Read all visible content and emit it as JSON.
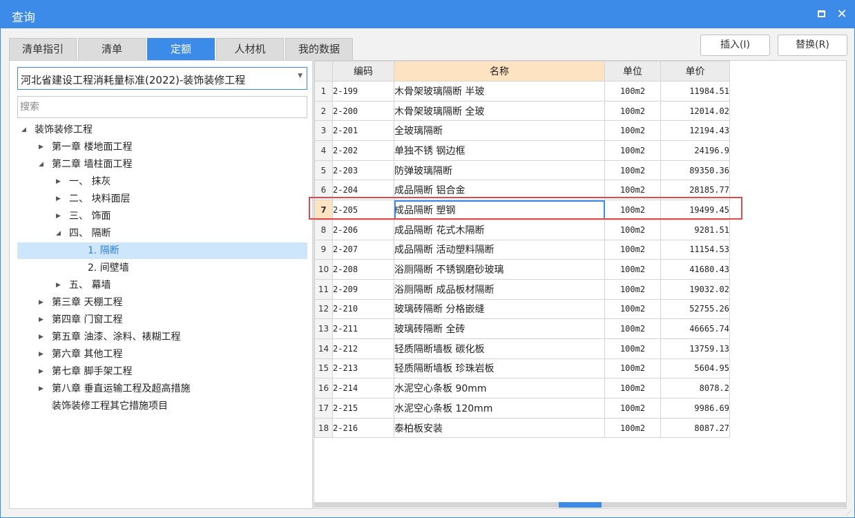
{
  "window": {
    "title": "查询"
  },
  "tabs": [
    "清单指引",
    "清单",
    "定额",
    "人材机",
    "我的数据"
  ],
  "active_tab": "定额",
  "buttons": {
    "insert": "插入(I)",
    "replace": "替换(R)"
  },
  "left": {
    "select_value": "河北省建设工程消耗量标准(2022)-装饰装修工程",
    "search_placeholder": "搜索",
    "tree": [
      {
        "label": "装饰装修工程",
        "level": 0,
        "caret": "expanded"
      },
      {
        "label": "第一章 楼地面工程",
        "level": 1,
        "caret": "collapsed"
      },
      {
        "label": "第二章 墙柱面工程",
        "level": 1,
        "caret": "expanded"
      },
      {
        "label": "一、 抹灰",
        "level": 2,
        "caret": "collapsed"
      },
      {
        "label": "二、 块料面层",
        "level": 2,
        "caret": "collapsed"
      },
      {
        "label": "三、 饰面",
        "level": 2,
        "caret": "collapsed"
      },
      {
        "label": "四、 隔断",
        "level": 2,
        "caret": "expanded"
      },
      {
        "label": "1. 隔断",
        "level": 3,
        "caret": "none",
        "selected": true
      },
      {
        "label": "2. 间壁墙",
        "level": 3,
        "caret": "none"
      },
      {
        "label": "五、 幕墙",
        "level": 2,
        "caret": "collapsed"
      },
      {
        "label": "第三章 天棚工程",
        "level": 1,
        "caret": "collapsed"
      },
      {
        "label": "第四章 门窗工程",
        "level": 1,
        "caret": "collapsed"
      },
      {
        "label": "第五章 油漆、涂料、裱糊工程",
        "level": 1,
        "caret": "collapsed"
      },
      {
        "label": "第六章 其他工程",
        "level": 1,
        "caret": "collapsed"
      },
      {
        "label": "第七章 脚手架工程",
        "level": 1,
        "caret": "collapsed"
      },
      {
        "label": "第八章 垂直运输工程及超高措施",
        "level": 1,
        "caret": "collapsed"
      },
      {
        "label": "装饰装修工程其它措施项目",
        "level": 1,
        "caret": "none"
      }
    ]
  },
  "table": {
    "headers": {
      "code": "编码",
      "name": "名称",
      "unit": "单位",
      "price": "单价"
    },
    "selected_row": 7,
    "rows": [
      {
        "no": "1",
        "code": "2-199",
        "name": "木骨架玻璃隔断 半玻",
        "unit": "100m2",
        "price": "11984.51"
      },
      {
        "no": "2",
        "code": "2-200",
        "name": "木骨架玻璃隔断 全玻",
        "unit": "100m2",
        "price": "12014.02"
      },
      {
        "no": "3",
        "code": "2-201",
        "name": "全玻璃隔断",
        "unit": "100m2",
        "price": "12194.43"
      },
      {
        "no": "4",
        "code": "2-202",
        "name": "单独不锈 钢边框",
        "unit": "100m2",
        "price": "24196.9"
      },
      {
        "no": "5",
        "code": "2-203",
        "name": "防弹玻璃隔断",
        "unit": "100m2",
        "price": "89350.36"
      },
      {
        "no": "6",
        "code": "2-204",
        "name": "成品隔断 铝合金",
        "unit": "100m2",
        "price": "28185.77"
      },
      {
        "no": "7",
        "code": "2-205",
        "name": "成品隔断 塑钢",
        "unit": "100m2",
        "price": "19499.45"
      },
      {
        "no": "8",
        "code": "2-206",
        "name": "成品隔断 花式木隔断",
        "unit": "100m2",
        "price": "9281.51"
      },
      {
        "no": "9",
        "code": "2-207",
        "name": "成品隔断 活动塑料隔断",
        "unit": "100m2",
        "price": "11154.53"
      },
      {
        "no": "10",
        "code": "2-208",
        "name": "浴厕隔断 不锈钢磨砂玻璃",
        "unit": "100m2",
        "price": "41680.43"
      },
      {
        "no": "11",
        "code": "2-209",
        "name": "浴厕隔断 成品板材隔断",
        "unit": "100m2",
        "price": "19032.02"
      },
      {
        "no": "12",
        "code": "2-210",
        "name": "玻璃砖隔断 分格嵌缝",
        "unit": "100m2",
        "price": "52755.26"
      },
      {
        "no": "13",
        "code": "2-211",
        "name": "玻璃砖隔断 全砖",
        "unit": "100m2",
        "price": "46665.74"
      },
      {
        "no": "14",
        "code": "2-212",
        "name": "轻质隔断墙板 碳化板",
        "unit": "100m2",
        "price": "13759.13"
      },
      {
        "no": "15",
        "code": "2-213",
        "name": "轻质隔断墙板 珍珠岩板",
        "unit": "100m2",
        "price": "5604.95"
      },
      {
        "no": "16",
        "code": "2-214",
        "name": "水泥空心条板 90mm",
        "unit": "100m2",
        "price": "8078.2"
      },
      {
        "no": "17",
        "code": "2-215",
        "name": "水泥空心条板 120mm",
        "unit": "100m2",
        "price": "9986.69"
      },
      {
        "no": "18",
        "code": "2-216",
        "name": "泰柏板安装",
        "unit": "100m2",
        "price": "8087.27"
      }
    ]
  }
}
